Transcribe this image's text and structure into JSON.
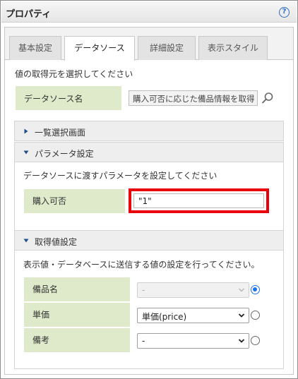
{
  "window": {
    "title": "プロパティ",
    "help_icon": "?"
  },
  "tabs": [
    {
      "label": "基本設定",
      "active": false
    },
    {
      "label": "データソース",
      "active": true
    },
    {
      "label": "詳細設定",
      "active": false
    },
    {
      "label": "表示スタイル",
      "active": false
    }
  ],
  "datasource": {
    "instruction": "値の取得元を選択してください",
    "name_label": "データソース名",
    "name_value": "購入可否に応じた備品情報を取得"
  },
  "sections": {
    "list_select": {
      "label": "一覧選択画面",
      "expanded": false
    },
    "params": {
      "label": "パラメータ設定",
      "expanded": true,
      "description": "データソースに渡すパラメータを設定してください",
      "rows": [
        {
          "label": "購入可否",
          "value": "\"1\""
        }
      ]
    },
    "fetch": {
      "label": "取得値設定",
      "expanded": true,
      "description": "表示値・データベースに送信する値の設定を行ってください。",
      "rows": [
        {
          "label": "備品名",
          "select": "-",
          "disabled": true,
          "radio_selected": true
        },
        {
          "label": "単価",
          "select": "単価(price)",
          "disabled": false,
          "radio_selected": false
        },
        {
          "label": "備考",
          "select": "-",
          "disabled": false,
          "radio_selected": false
        }
      ]
    }
  },
  "colors": {
    "accent_green": "#dfeacb",
    "highlight_red": "#e8000b",
    "radio_blue": "#1a73e8"
  }
}
